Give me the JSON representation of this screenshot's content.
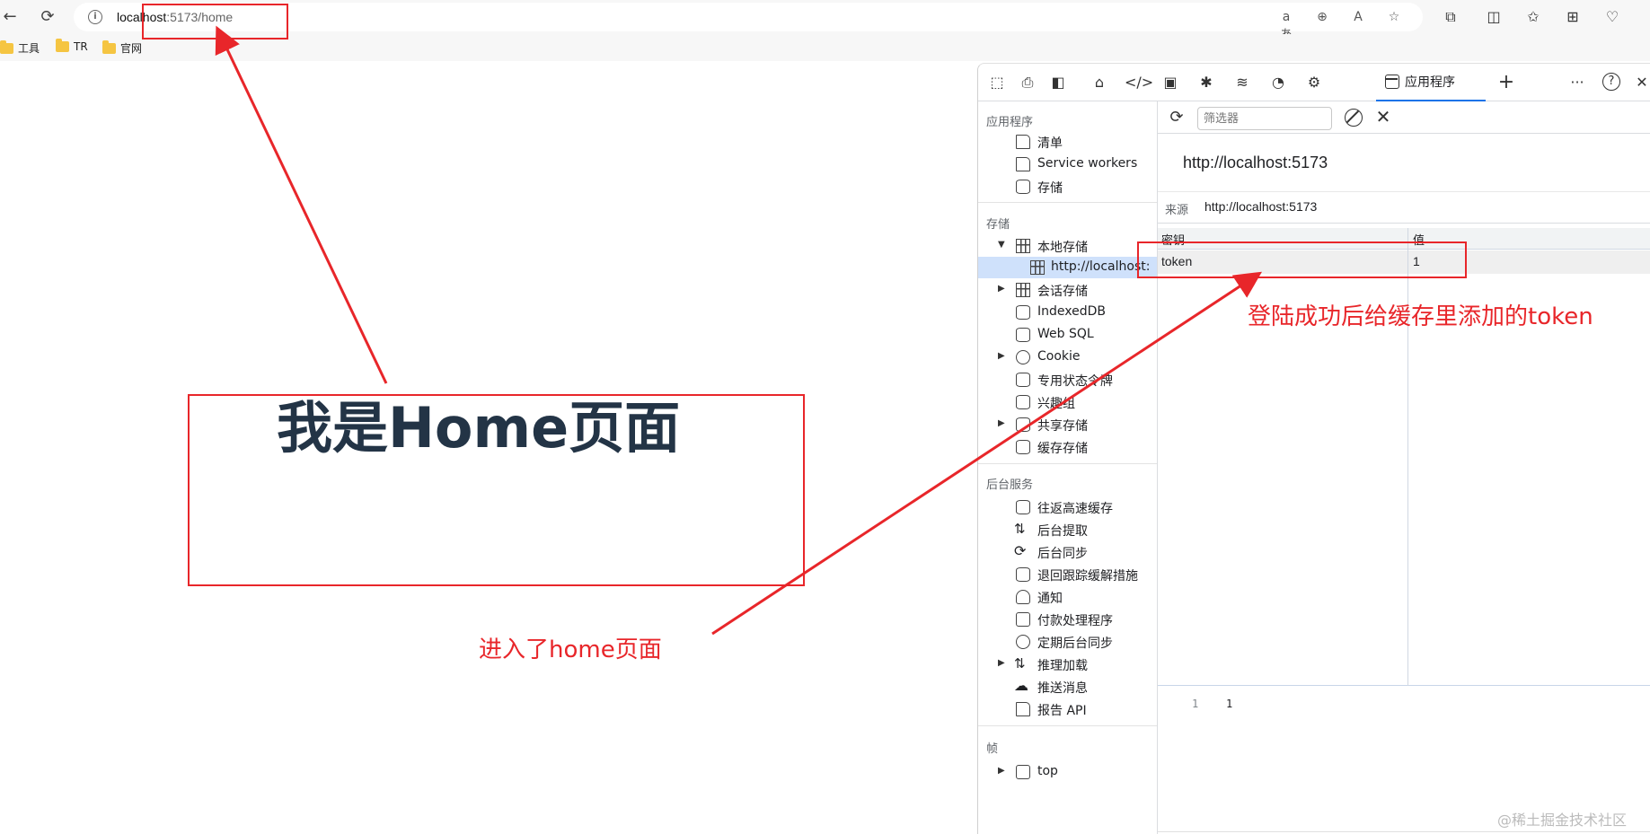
{
  "browser": {
    "back_glyph": "←",
    "reload_glyph": "⟳",
    "url_host": "localhost",
    "url_rest": ":5173/home",
    "info_glyph": "i",
    "addr_tools": [
      "aあ",
      "⊕",
      "A",
      "☆"
    ],
    "toolbar_glyphs": [
      "⧉",
      "◫",
      "✩",
      "⊞",
      "♡"
    ],
    "bookmarks": [
      {
        "label": "工具"
      },
      {
        "label": "TR"
      },
      {
        "label": "官网"
      }
    ]
  },
  "page": {
    "heading": "我是Home页面"
  },
  "devtools": {
    "toolbar_glyphs": {
      "inspect": "⬚",
      "device": "⎙",
      "dock": "◧",
      "home": "⌂",
      "sources": "</>",
      "console": "▣",
      "bug": "✱",
      "network": "≋",
      "performance": "◔",
      "memory": "⚙",
      "add": "+",
      "more": "···",
      "help": "?",
      "close": "✕"
    },
    "active_tab": "应用程序",
    "sidebar": {
      "app_section": "应用程序",
      "app_items": [
        "清单",
        "Service workers",
        "存储"
      ],
      "storage_section": "存储",
      "storage_items": [
        "本地存储",
        "http://localhost:",
        "会话存储",
        "IndexedDB",
        "Web SQL",
        "Cookie",
        "专用状态令牌",
        "兴趣组",
        "共享存储",
        "缓存存储"
      ],
      "bg_section": "后台服务",
      "bg_items": [
        "往返高速缓存",
        "后台提取",
        "后台同步",
        "退回跟踪缓解措施",
        "通知",
        "付款处理程序",
        "定期后台同步",
        "推理加载",
        "推送消息",
        "报告 API"
      ],
      "frames_section": "帧",
      "frames_items": [
        "top"
      ]
    },
    "main": {
      "refresh_glyph": "⟳",
      "close_glyph": "✕",
      "filter_placeholder": "筛选器",
      "origin_title": "http://localhost:5173",
      "origin_label": "来源",
      "origin_value": "http://localhost:5173",
      "table_headers": [
        "密钥",
        "值"
      ],
      "rows": [
        {
          "key": "token",
          "value": "1"
        }
      ],
      "preview_line": "1",
      "preview_value": "1"
    }
  },
  "annotations": {
    "token_note": "登陆成功后给缓存里添加的token",
    "home_note": "进入了home页面",
    "color": "#e8262a"
  },
  "watermark": "@稀土掘金技术社区"
}
